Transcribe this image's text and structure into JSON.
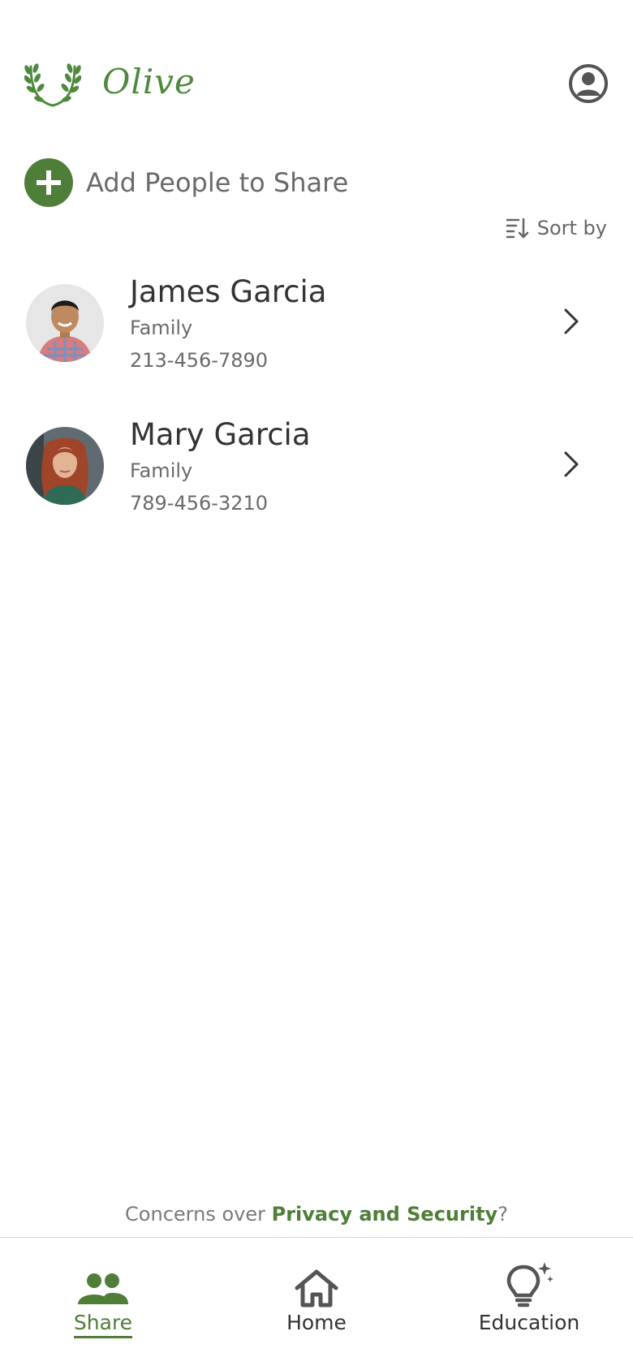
{
  "header": {
    "brand": "Olive"
  },
  "actions": {
    "add_label": "Add People to Share",
    "sort_label": "Sort by"
  },
  "contacts": [
    {
      "name": "James Garcia",
      "relation": "Family",
      "phone": "213-456-7890"
    },
    {
      "name": "Mary Garcia",
      "relation": "Family",
      "phone": "789-456-3210"
    }
  ],
  "footer": {
    "privacy_prefix": "Concerns over ",
    "privacy_link": "Privacy and Security",
    "privacy_suffix": "?"
  },
  "nav": {
    "items": [
      {
        "label": "Share",
        "icon": "people-icon",
        "active": true
      },
      {
        "label": "Home",
        "icon": "home-icon",
        "active": false
      },
      {
        "label": "Education",
        "icon": "lightbulb-icon",
        "active": false
      }
    ]
  },
  "colors": {
    "accent": "#4e7e37",
    "brand": "#4e8a3e"
  }
}
